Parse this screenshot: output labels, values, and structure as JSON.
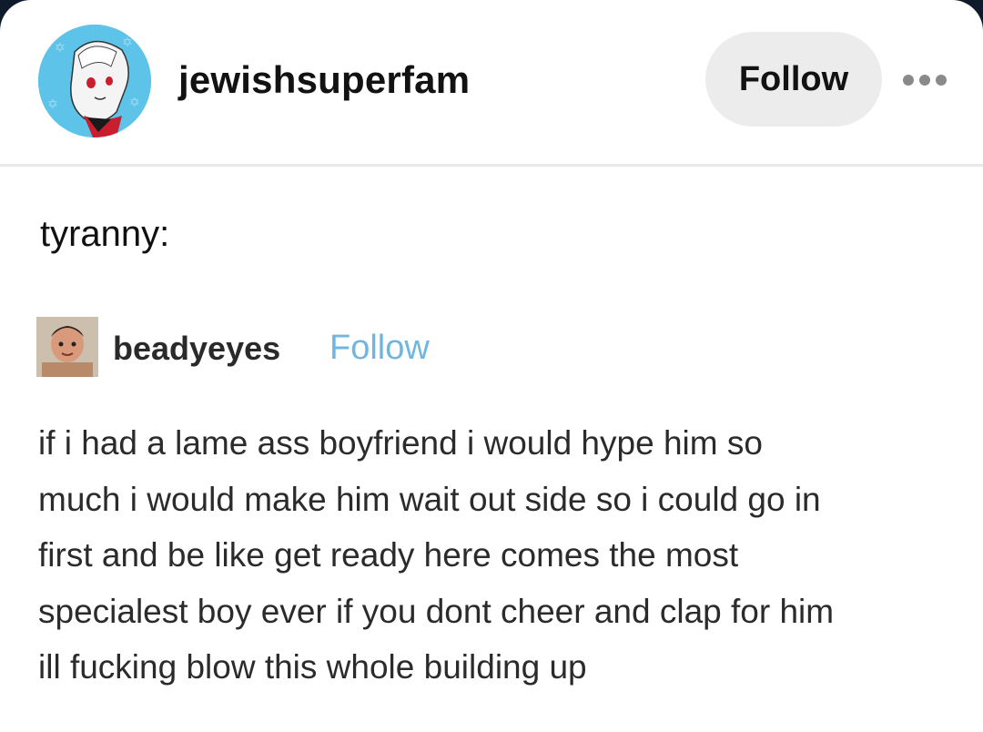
{
  "post": {
    "author": {
      "username": "jewishsuperfam",
      "avatar_icon": "anime-character-avatar"
    },
    "follow_label": "Follow",
    "more_icon": "ellipsis-icon",
    "caption": "tyranny:",
    "reblog": {
      "username": "beadyeyes",
      "follow_label": "Follow",
      "avatar_icon": "photo-avatar",
      "text_lines": [
        "if i had a lame ass boyfriend i would hype him so",
        "much i would make him wait out side so i could go in",
        "first and be like get ready here comes the most",
        "specialest boy ever if you dont cheer and clap for him",
        "ill fucking blow this whole building up"
      ]
    }
  },
  "colors": {
    "follow_button_bg": "#ececec",
    "reblog_follow_link": "#6fb7df",
    "avatar_bg": "#5ec3e8"
  }
}
